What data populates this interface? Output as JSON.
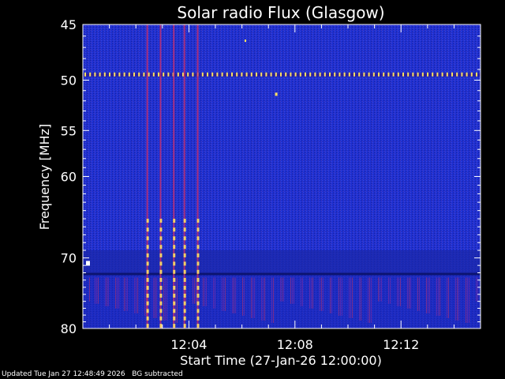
{
  "chart_data": {
    "type": "heatmap",
    "title": "Solar radio Flux (Glasgow)",
    "xlabel": "Start Time (27-Jan-26 12:00:00)",
    "ylabel": "Frequency [MHz]",
    "x_unit": "minutes",
    "xlim": [
      0,
      15.0
    ],
    "ylim": [
      80,
      45
    ],
    "y_scale": "log",
    "x_ticks": [
      {
        "value": 4,
        "label": "12:04"
      },
      {
        "value": 8,
        "label": "12:08"
      },
      {
        "value": 12,
        "label": "12:12"
      }
    ],
    "y_ticks": [
      {
        "value": 45,
        "label": "45"
      },
      {
        "value": 50,
        "label": "50"
      },
      {
        "value": 55,
        "label": "55"
      },
      {
        "value": 60,
        "label": "60"
      },
      {
        "value": 70,
        "label": "70"
      },
      {
        "value": 80,
        "label": "80"
      }
    ],
    "background_color": "#1e2fd0",
    "intense_color": "#ffe060",
    "interference_band_mhz": 49.5,
    "bursts": [
      {
        "start_min": 2.4,
        "freq_range_mhz": [
          45,
          80
        ]
      },
      {
        "start_min": 2.9,
        "freq_range_mhz": [
          45,
          80
        ]
      },
      {
        "start_min": 3.4,
        "freq_range_mhz": [
          45,
          80
        ]
      },
      {
        "start_min": 3.8,
        "freq_range_mhz": [
          45,
          80
        ]
      },
      {
        "start_min": 4.3,
        "freq_range_mhz": [
          45,
          80
        ]
      }
    ]
  },
  "footer": {
    "updated": "Updated Tue Jan 27 12:48:49 2026",
    "note": "BG subtracted"
  }
}
